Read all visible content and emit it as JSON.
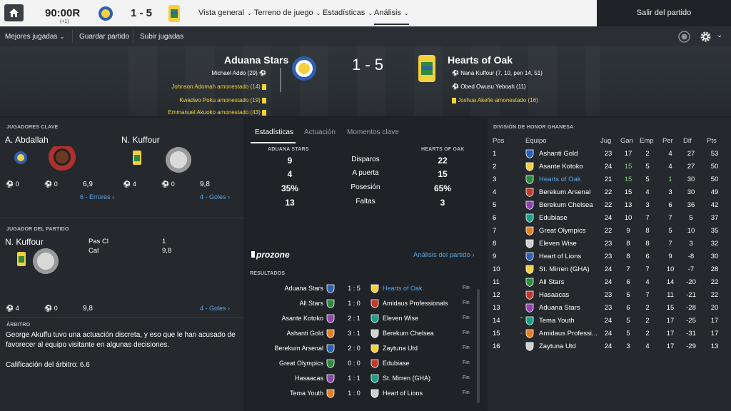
{
  "topbar": {
    "clock": "90:00R",
    "clock_extra": "(+1)",
    "score": "1 - 5",
    "nav": [
      {
        "label": "Vista general"
      },
      {
        "label": "Terreno de juego"
      },
      {
        "label": "Estadísticas"
      },
      {
        "label": "Análisis"
      }
    ],
    "exit": "Salir del partido"
  },
  "subbar": {
    "items": [
      "Mejores jugadas",
      "Guardar partido",
      "Subir jugadas"
    ]
  },
  "match": {
    "home": "Aduana Stars",
    "away": "Hearts of Oak",
    "score": "1 - 5",
    "home_events": [
      "Michael Addo (29)",
      "Johnson Adomah amonestado (14)",
      "Kwadwo Poku amonestado (19)",
      "Emmanuel Akuoko amonestado (43)"
    ],
    "away_events": [
      "Nana Kuffour (7, 10, pen 14, 51)",
      "Obed Owusu Yeboah (11)",
      "Joshua Akefie amonestado (16)"
    ]
  },
  "key_players": {
    "title": "JUGADORES CLAVE",
    "home_name": "A. Abdallah",
    "away_name": "N. Kuffour",
    "home_stats": [
      "0",
      "0",
      "6,9"
    ],
    "away_stats": [
      "4",
      "0",
      "9,8"
    ],
    "home_link": "6 - Errores",
    "away_link": "4 - Goles"
  },
  "potm": {
    "title": "JUGADOR DEL PARTIDO",
    "name": "N. Kuffour",
    "k1": "Pas Cl",
    "v1": "1",
    "k2": "Cal",
    "v2": "9,8",
    "stats": [
      "4",
      "0",
      "9,8"
    ],
    "link": "4 - Goles"
  },
  "referee": {
    "title": "ÁRBITRO",
    "text1": "George Akuffu tuvo una actuación discreta, y eso que le han acusado de",
    "text2": "favorecer al equipo visitante en algunas decisiones.",
    "rating": "Calificación del árbitro: 6.6"
  },
  "stats": {
    "tabs": [
      "Estadísticas",
      "Actuación",
      "Momentos clave"
    ],
    "home_head": "ADUANA STARS",
    "away_head": "HEARTS OF OAK",
    "rows": [
      {
        "home": "9",
        "label": "Disparos",
        "away": "22"
      },
      {
        "home": "4",
        "label": "A puerta",
        "away": "15"
      },
      {
        "home": "35%",
        "label": "Posesión",
        "away": "65%"
      },
      {
        "home": "13",
        "label": "Faltas",
        "away": "3"
      }
    ]
  },
  "prozone": {
    "logo": "prozone",
    "link": "Análisis del partido"
  },
  "results": {
    "title": "RESULTADOS",
    "rows": [
      {
        "home": "Aduana Stars",
        "score": "1 : 5",
        "away": "Hearts of Oak",
        "status": "Fin"
      },
      {
        "home": "All Stars",
        "score": "1 : 0",
        "away": "Amidaus Professionals",
        "status": "Fin"
      },
      {
        "home": "Asante Kotoko",
        "score": "2 : 1",
        "away": "Eleven Wise",
        "status": "Fin"
      },
      {
        "home": "Ashanti Gold",
        "score": "3 : 1",
        "away": "Berekum Chelsea",
        "status": "Fin"
      },
      {
        "home": "Berekum Arsenal",
        "score": "2 : 0",
        "away": "Zaytuna Utd",
        "status": "Fin"
      },
      {
        "home": "Great Olympics",
        "score": "0 : 0",
        "away": "Edubiase",
        "status": "Fin"
      },
      {
        "home": "Hasaacas",
        "score": "1 : 1",
        "away": "St. Mirren (GHA)",
        "status": "Fin"
      },
      {
        "home": "Tema Youth",
        "score": "1 : 0",
        "away": "Heart of Lions",
        "status": "Fin"
      }
    ]
  },
  "league": {
    "title": "DIVISIÓN DE HONOR GHANESA",
    "headers": [
      "Pos",
      "Equipo",
      "Jug",
      "Gan",
      "Emp",
      "Per",
      "Dif",
      "Pts"
    ],
    "rows": [
      {
        "pos": "1",
        "team": "Ashanti Gold",
        "p": "23",
        "w": "17",
        "d": "2",
        "l": "4",
        "gd": "27",
        "pts": "53"
      },
      {
        "pos": "2",
        "team": "Asante Kotoko",
        "p": "24",
        "w": "15",
        "d": "5",
        "l": "4",
        "gd": "27",
        "pts": "50"
      },
      {
        "pos": "3",
        "team": "Hearts of Oak",
        "p": "21",
        "w": "15",
        "d": "5",
        "l": "1",
        "gd": "30",
        "pts": "50"
      },
      {
        "pos": "4",
        "team": "Berekum Arsenal",
        "p": "22",
        "w": "15",
        "d": "4",
        "l": "3",
        "gd": "30",
        "pts": "49"
      },
      {
        "pos": "5",
        "team": "Berekum Chelsea",
        "p": "22",
        "w": "13",
        "d": "3",
        "l": "6",
        "gd": "36",
        "pts": "42"
      },
      {
        "pos": "6",
        "team": "Edubiase",
        "p": "24",
        "w": "10",
        "d": "7",
        "l": "7",
        "gd": "5",
        "pts": "37"
      },
      {
        "pos": "7",
        "team": "Great Olympics",
        "p": "22",
        "w": "9",
        "d": "8",
        "l": "5",
        "gd": "10",
        "pts": "35"
      },
      {
        "pos": "8",
        "team": "Eleven Wise",
        "p": "23",
        "w": "8",
        "d": "8",
        "l": "7",
        "gd": "3",
        "pts": "32"
      },
      {
        "pos": "9",
        "team": "Heart of Lions",
        "p": "23",
        "w": "8",
        "d": "6",
        "l": "9",
        "gd": "-8",
        "pts": "30"
      },
      {
        "pos": "10",
        "team": "St. Mirren (GHA)",
        "p": "24",
        "w": "7",
        "d": "7",
        "l": "10",
        "gd": "-7",
        "pts": "28"
      },
      {
        "pos": "11",
        "team": "All Stars",
        "p": "24",
        "w": "6",
        "d": "4",
        "l": "14",
        "gd": "-20",
        "pts": "22"
      },
      {
        "pos": "12",
        "team": "Hasaacas",
        "p": "23",
        "w": "5",
        "d": "7",
        "l": "11",
        "gd": "-21",
        "pts": "22"
      },
      {
        "pos": "13",
        "team": "Aduana Stars",
        "p": "23",
        "w": "6",
        "d": "2",
        "l": "15",
        "gd": "-28",
        "pts": "20"
      },
      {
        "pos": "14",
        "team": "Tema Youth",
        "p": "24",
        "w": "5",
        "d": "2",
        "l": "17",
        "gd": "-25",
        "pts": "17"
      },
      {
        "pos": "15",
        "team": "Amidaus Professi...",
        "p": "24",
        "w": "5",
        "d": "2",
        "l": "17",
        "gd": "-31",
        "pts": "17"
      },
      {
        "pos": "16",
        "team": "Zaytuna Utd",
        "p": "24",
        "w": "3",
        "d": "4",
        "l": "17",
        "gd": "-29",
        "pts": "13"
      }
    ]
  },
  "colors": {
    "accent": "#5aa5e6",
    "card": "#f2d33a",
    "highlight_green": "#7fd17f"
  }
}
